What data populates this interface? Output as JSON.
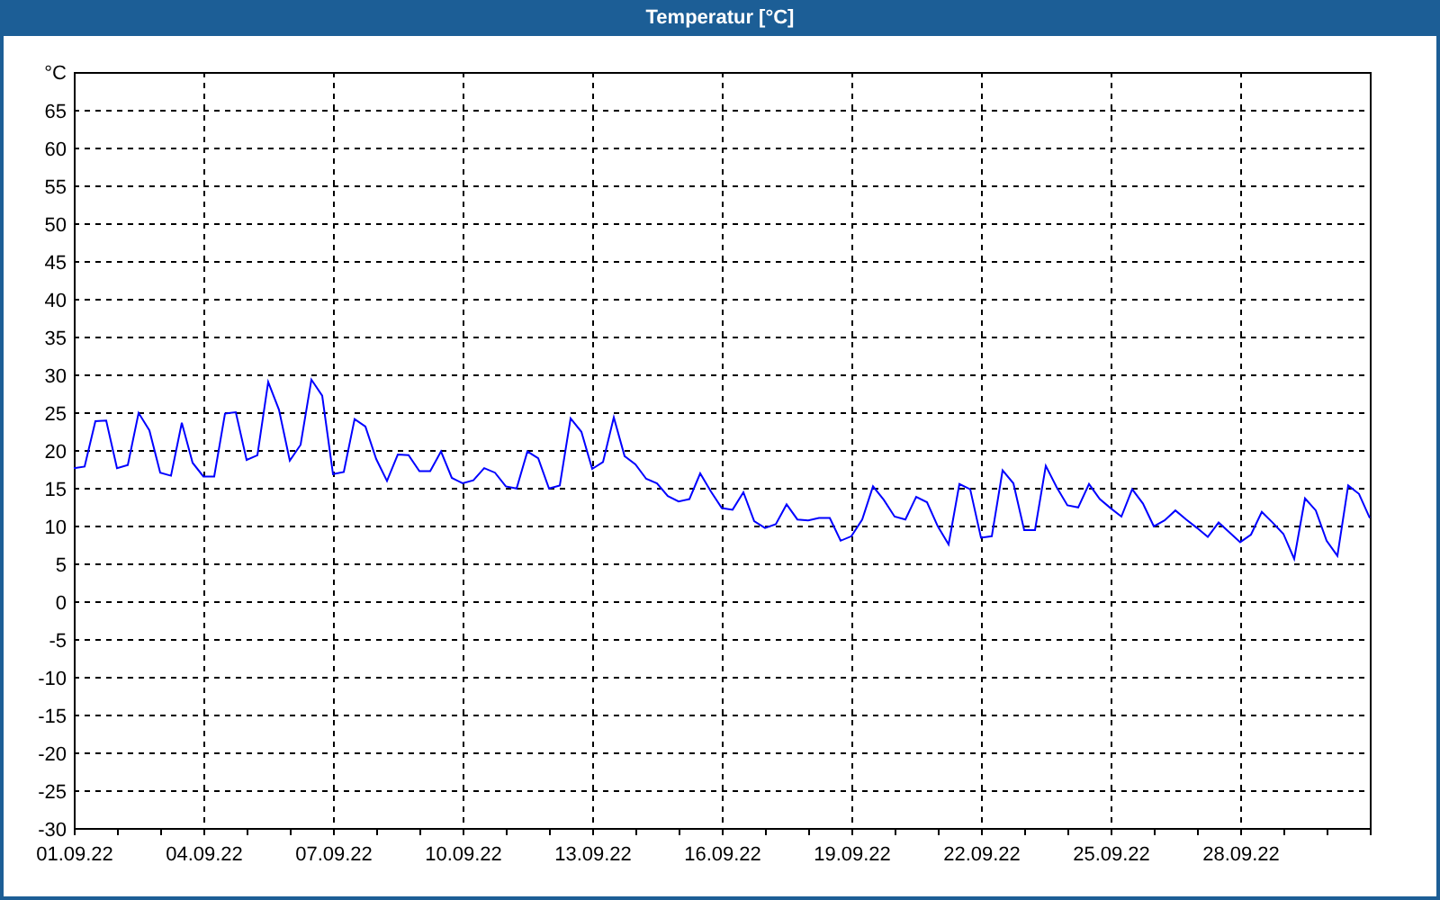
{
  "window": {
    "title": "Temperatur [°C]"
  },
  "chart_data": {
    "type": "line",
    "ylabel": "°C",
    "grid": true,
    "ylim": [
      -30,
      70
    ],
    "yticks": [
      -30,
      -25,
      -20,
      -15,
      -10,
      -5,
      0,
      5,
      10,
      15,
      20,
      25,
      30,
      35,
      40,
      45,
      50,
      55,
      60,
      65
    ],
    "categories": [
      "01.09.22",
      null,
      null,
      null,
      null,
      null,
      null,
      null,
      null,
      null,
      null,
      null,
      "04.09.22",
      null,
      null,
      null,
      null,
      null,
      null,
      null,
      null,
      null,
      null,
      null,
      "07.09.22",
      null,
      null,
      null,
      null,
      null,
      null,
      null,
      null,
      null,
      null,
      null,
      "10.09.22",
      null,
      null,
      null,
      null,
      null,
      null,
      null,
      null,
      null,
      null,
      null,
      "13.09.22",
      null,
      null,
      null,
      null,
      null,
      null,
      null,
      null,
      null,
      null,
      null,
      "16.09.22",
      null,
      null,
      null,
      null,
      null,
      null,
      null,
      null,
      null,
      null,
      null,
      "19.09.22",
      null,
      null,
      null,
      null,
      null,
      null,
      null,
      null,
      null,
      null,
      null,
      "22.09.22",
      null,
      null,
      null,
      null,
      null,
      null,
      null,
      null,
      null,
      null,
      null,
      "25.09.22",
      null,
      null,
      null,
      null,
      null,
      null,
      null,
      null,
      null,
      null,
      null,
      "28.09.22",
      null,
      null,
      null,
      null,
      null,
      null,
      null,
      null,
      null,
      null,
      null,
      null
    ],
    "series": [
      {
        "color": "#0000ff",
        "values": [
          17.6,
          17.8,
          23.8,
          23.9,
          17.6,
          18.0,
          24.9,
          22.6,
          17.0,
          16.6,
          23.6,
          18.3,
          16.5,
          16.5,
          24.8,
          25.0,
          18.7,
          19.3,
          29.0,
          25.3,
          18.6,
          20.7,
          29.3,
          27.2,
          16.8,
          17.1,
          24.1,
          23.1,
          18.8,
          15.9,
          19.4,
          19.3,
          17.2,
          17.2,
          19.8,
          16.3,
          15.6,
          16.0,
          17.6,
          17.0,
          15.2,
          14.9,
          19.8,
          18.9,
          14.9,
          15.3,
          24.2,
          22.4,
          17.5,
          18.4,
          24.3,
          19.2,
          18.1,
          16.2,
          15.6,
          13.9,
          13.2,
          13.5,
          16.9,
          14.5,
          12.3,
          12.1,
          14.4,
          10.6,
          9.7,
          10.2,
          12.8,
          10.8,
          10.7,
          11.0,
          11.0,
          8.0,
          8.6,
          10.8,
          15.2,
          13.4,
          11.2,
          10.8,
          13.8,
          13.1,
          9.9,
          7.5,
          15.5,
          14.8,
          8.4,
          8.6,
          17.3,
          15.6,
          9.4,
          9.4,
          17.9,
          15.1,
          12.7,
          12.4,
          15.5,
          13.5,
          12.3,
          11.2,
          14.8,
          12.9,
          9.9,
          10.7,
          12.0,
          10.8,
          9.7,
          8.5,
          10.4,
          9.1,
          7.8,
          8.8,
          11.8,
          10.4,
          8.9,
          5.6,
          13.6,
          12.0,
          8.0,
          6.0,
          15.3,
          14.2,
          11.0
        ]
      }
    ]
  }
}
